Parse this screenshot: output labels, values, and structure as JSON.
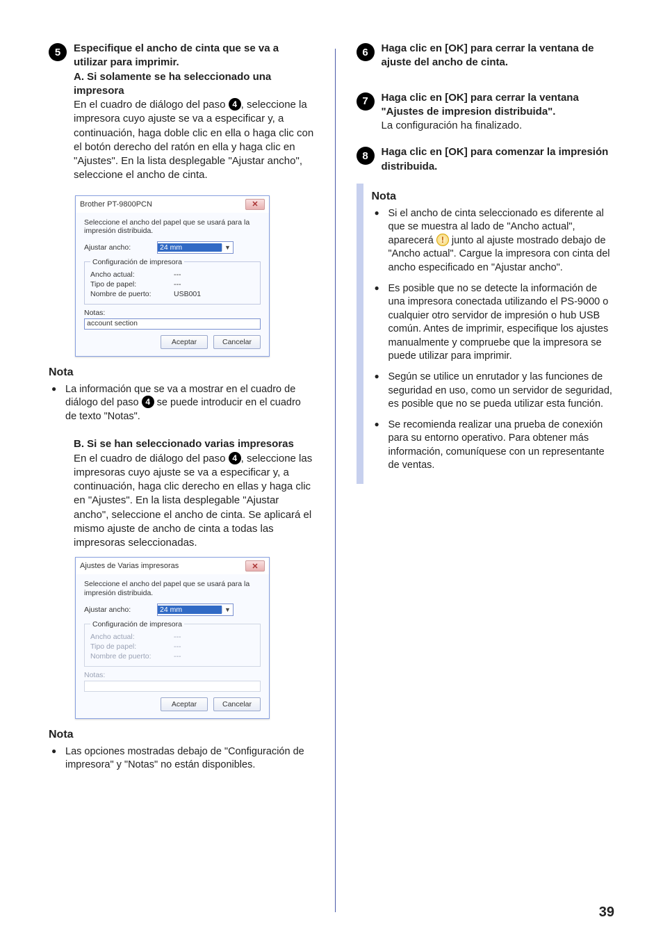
{
  "page_number": "39",
  "left": {
    "step5": {
      "num": "5",
      "title": "Especifique el ancho de cinta que se va a utilizar para imprimir.",
      "subA_title": "A. Si solamente se ha seleccionado una impresora",
      "subA_text1": "En el cuadro de diálogo del paso ",
      "ref4": "4",
      "subA_text2": ", seleccione la impresora cuyo ajuste se va a especificar y, a continuación, haga doble clic en ella o haga clic con el botón derecho del ratón en ella y haga clic en \"Ajustes\". En la lista desplegable \"Ajustar ancho\", seleccione el ancho de cinta."
    },
    "ss1": {
      "title": "Brother PT-9800PCN",
      "desc": "Seleccione el ancho del papel que se usará para la impresión distribuida.",
      "adjust_label": "Ajustar ancho:",
      "adjust_value": "24 mm",
      "group_legend": "Configuración de impresora",
      "k_width": "Ancho actual:",
      "v_width": "---",
      "k_paper": "Tipo de papel:",
      "v_paper": "---",
      "k_port": "Nombre de puerto:",
      "v_port": "USB001",
      "notes_label": "Notas:",
      "notes_value": "account section",
      "ok": "Aceptar",
      "cancel": "Cancelar"
    },
    "nota1": {
      "heading": "Nota",
      "text1": "La información que se va a mostrar en el cuadro de diálogo del paso ",
      "ref4": "4",
      "text2": " se puede introducir en el cuadro de texto \"Notas\"."
    },
    "subB": {
      "title": "B. Si se han seleccionado varias impresoras",
      "text1": "En el cuadro de diálogo del paso ",
      "ref4": "4",
      "text2": ", seleccione las impresoras cuyo ajuste se va a especificar y, a continuación, haga clic derecho en ellas y haga clic en \"Ajustes\". En la lista desplegable \"Ajustar ancho\", seleccione el ancho de cinta. Se aplicará el mismo ajuste de ancho de cinta a todas las impresoras seleccionadas."
    },
    "ss2": {
      "title": "Ajustes de Varias impresoras",
      "desc": "Seleccione el ancho del papel que se usará para la impresión distribuida.",
      "adjust_label": "Ajustar ancho:",
      "adjust_value": "24 mm",
      "group_legend": "Configuración de impresora",
      "k_width": "Ancho actual:",
      "v_width": "---",
      "k_paper": "Tipo de papel:",
      "v_paper": "---",
      "k_port": "Nombre de puerto:",
      "v_port": "---",
      "notes_label": "Notas:",
      "ok": "Aceptar",
      "cancel": "Cancelar"
    },
    "nota2": {
      "heading": "Nota",
      "text": "Las opciones mostradas debajo de \"Configuración de impresora\" y \"Notas\" no están disponibles."
    }
  },
  "right": {
    "step6": {
      "num": "6",
      "text": "Haga clic en [OK] para cerrar la ventana de ajuste del ancho de cinta."
    },
    "step7": {
      "num": "7",
      "bold": "Haga clic en [OK] para cerrar la ventana \"Ajustes de impresion distribuida\".",
      "plain": "La configuración ha finalizado."
    },
    "step8": {
      "num": "8",
      "text": "Haga clic en [OK] para comenzar la impresión distribuida."
    },
    "nota": {
      "heading": "Nota",
      "b1a": "Si el ancho de cinta seleccionado es diferente al que se muestra al lado de \"Ancho actual\", aparecerá ",
      "b1b": " junto al ajuste mostrado debajo de \"Ancho actual\". Cargue la impresora con cinta del ancho especificado en \"Ajustar ancho\".",
      "b2": "Es posible que no se detecte la información de una impresora conectada utilizando el PS-9000 o cualquier otro servidor de impresión o hub USB común. Antes de imprimir, especifique los ajustes manualmente y compruebe que la impresora se puede utilizar para imprimir.",
      "b3": "Según se utilice un enrutador y las funciones de seguridad en uso, como un servidor de seguridad, es posible que no se pueda utilizar esta función.",
      "b4": "Se recomienda realizar una prueba de conexión para su entorno operativo. Para obtener más información, comuníquese con un representante de ventas."
    }
  }
}
